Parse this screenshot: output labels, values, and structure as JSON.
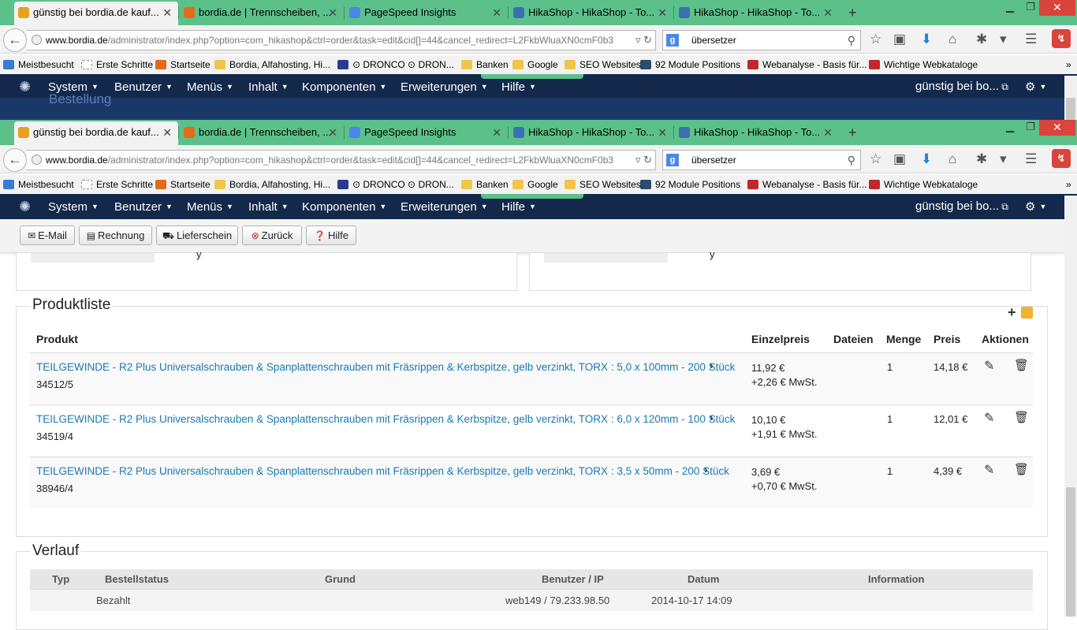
{
  "browser": {
    "tabs": [
      {
        "title": "günstig bei bordia.de kauf...",
        "active": true,
        "icon_color": "#e8a020"
      },
      {
        "title": "bordia.de | Trennscheiben, ...",
        "active": false,
        "icon_color": "#e46a1a"
      },
      {
        "title": "PageSpeed Insights",
        "active": false,
        "icon_color": "#4a87e8"
      },
      {
        "title": "HikaShop - HikaShop - To...",
        "active": false,
        "icon_color": "#3a6fb3"
      },
      {
        "title": "HikaShop - HikaShop - To...",
        "active": false,
        "icon_color": "#3a6fb3"
      }
    ],
    "new_tab": "+",
    "url_domain": "www.bordia.de",
    "url_path": "/administrator/index.php?option=com_hikashop&ctrl=order&task=edit&cid[]=44&cancel_redirect=L2FkbWluaXN0cmF0b3",
    "search_value": "übersetzer",
    "bookmarks": [
      {
        "label": "Meistbesucht",
        "color": "#3a7bd5"
      },
      {
        "label": "Erste Schritte",
        "color": "#ffffff"
      },
      {
        "label": "Startseite",
        "color": "#e46a1a"
      },
      {
        "label": "Bordia, Alfahosting, Hi...",
        "color": "#f0c64a"
      },
      {
        "label": "⊙ DRONCO ⊙ DRON...",
        "color": "#2a3b8f"
      },
      {
        "label": "Banken",
        "color": "#f0c64a"
      },
      {
        "label": "Google",
        "color": "#f0c64a"
      },
      {
        "label": "SEO Websites",
        "color": "#f0c64a"
      },
      {
        "label": "92 Module Positions",
        "color": "#2b4d6b"
      },
      {
        "label": "Webanalyse - Basis für...",
        "color": "#c0282d"
      },
      {
        "label": "Wichtige Webkataloge",
        "color": "#c0282d"
      }
    ],
    "bookmarks_more": "»"
  },
  "joomla": {
    "menu": [
      "System",
      "Benutzer",
      "Menüs",
      "Inhalt",
      "Komponenten",
      "Erweiterungen",
      "Hilfe"
    ],
    "site_link": "günstig bei bo...",
    "partial_title": "Bestellung"
  },
  "toolbar": {
    "email": "E-Mail",
    "invoice": "Rechnung",
    "shipping": "Lieferschein",
    "back": "Zurück",
    "help": "Hilfe"
  },
  "products": {
    "legend": "Produktliste",
    "headers": {
      "product": "Produkt",
      "unit_price": "Einzelpreis",
      "files": "Dateien",
      "quantity": "Menge",
      "price": "Preis",
      "actions": "Aktionen"
    },
    "rows": [
      {
        "name": "TEILGEWINDE - R2 Plus Universalschrauben & Spanplattenschrauben mit Fräsrippen & Kerbspitze, gelb verzinkt, TORX : 5,0 x 100mm - 200 Stück",
        "code": "34512/5",
        "unit_price": "11,92 €",
        "tax": "+2,26 € MwSt.",
        "qty": "1",
        "total": "14,18 €"
      },
      {
        "name": "TEILGEWINDE - R2 Plus Universalschrauben & Spanplattenschrauben mit Fräsrippen & Kerbspitze, gelb verzinkt, TORX : 6,0 x 120mm - 100 Stück",
        "code": "34519/4",
        "unit_price": "10,10 €",
        "tax": "+1,91 € MwSt.",
        "qty": "1",
        "total": "12,01 €"
      },
      {
        "name": "TEILGEWINDE - R2 Plus Universalschrauben & Spanplattenschrauben mit Fräsrippen & Kerbspitze, gelb verzinkt, TORX : 3,5 x 50mm - 200 Stück",
        "code": "38946/4",
        "unit_price": "3,69 €",
        "tax": "+0,70 € MwSt.",
        "qty": "1",
        "total": "4,39 €"
      }
    ]
  },
  "history": {
    "legend": "Verlauf",
    "headers": {
      "type": "Typ",
      "status": "Bestellstatus",
      "reason": "Grund",
      "user_ip": "Benutzer / IP",
      "date": "Datum",
      "info": "Information"
    },
    "rows": [
      {
        "type": "",
        "status": "Bezahlt",
        "reason": "",
        "user_ip": "web149 / 79.233.98.50",
        "date": "2014-10-17 14:09",
        "info": ""
      }
    ]
  }
}
